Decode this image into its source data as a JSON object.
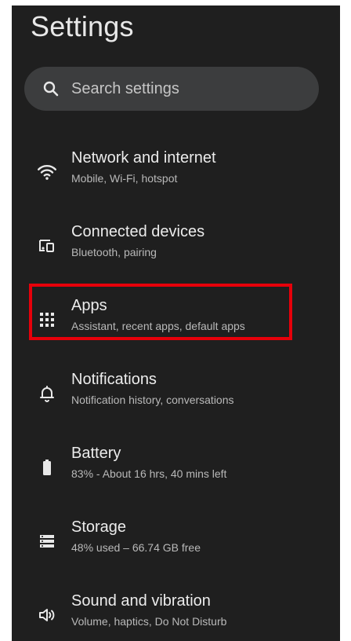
{
  "header": {
    "title": "Settings"
  },
  "search": {
    "placeholder": "Search settings"
  },
  "items": [
    {
      "label": "Network and internet",
      "sub": "Mobile, Wi-Fi, hotspot",
      "icon": "wifi-icon"
    },
    {
      "label": "Connected devices",
      "sub": "Bluetooth, pairing",
      "icon": "devices-icon"
    },
    {
      "label": "Apps",
      "sub": "Assistant, recent apps, default apps",
      "icon": "apps-grid-icon"
    },
    {
      "label": "Notifications",
      "sub": "Notification history, conversations",
      "icon": "bell-icon"
    },
    {
      "label": "Battery",
      "sub": "83% - About 16 hrs, 40 mins left",
      "icon": "battery-icon"
    },
    {
      "label": "Storage",
      "sub": "48% used – 66.74 GB free",
      "icon": "storage-icon"
    },
    {
      "label": "Sound and vibration",
      "sub": "Volume, haptics, Do Not Disturb",
      "icon": "speaker-icon"
    }
  ],
  "colors": {
    "background": "#1f1f1f",
    "search_bg": "#3c3d3e",
    "highlight": "#e6000a"
  }
}
